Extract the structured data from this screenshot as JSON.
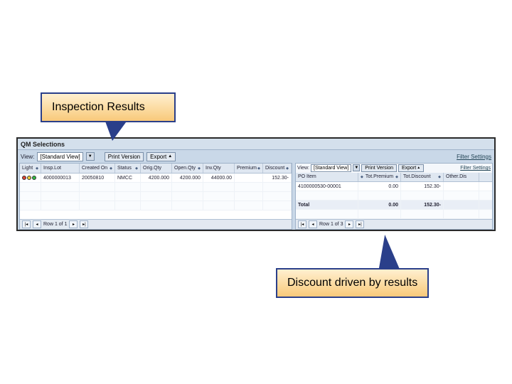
{
  "callouts": {
    "top": "Inspection Results",
    "bottom": "Discount driven by results"
  },
  "header": {
    "title": "QM Selections"
  },
  "left": {
    "toolbar": {
      "view_label": "View:",
      "view_value": "[Standard View]",
      "print": "Print Version",
      "export": "Export",
      "filter": "Filter Settings"
    },
    "columns": [
      "Light",
      "Insp.Lot",
      "Created On",
      "Status",
      "Orig.Qty",
      "Open.Qty",
      "Inv.Qty",
      "Premium",
      "Discount"
    ],
    "row": {
      "insp_lot": "4000000013",
      "created_on": "20050810",
      "status": "NMCC",
      "orig_qty": "4200.000",
      "open_qty": "4200.000",
      "inv_qty": "44000.00",
      "premium": "",
      "discount": "152.30-"
    },
    "pager": "Row 1 of 1"
  },
  "right": {
    "toolbar": {
      "view_label": "View:",
      "view_value": "[Standard View]",
      "print": "Print Version",
      "export": "Export",
      "filter": "Filter Settings"
    },
    "columns": [
      "PO Item",
      "Tot.Premium",
      "Tot.Discount",
      "Other.Dis"
    ],
    "row": {
      "po_item": "4100000530-00001",
      "tot_premium": "0.00",
      "tot_discount": "152.30-",
      "other": ""
    },
    "total": {
      "label": "Total",
      "tot_premium": "0.00",
      "tot_discount": "152.30-",
      "other": ""
    },
    "pager": "Row 1 of 3"
  }
}
